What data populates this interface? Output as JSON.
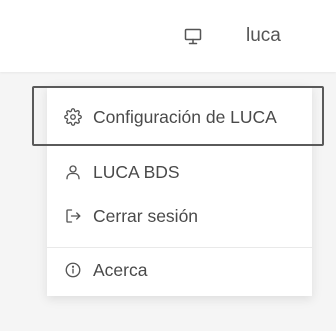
{
  "header": {
    "monitor_icon": "monitor-icon",
    "user_label": "luca"
  },
  "menu": {
    "items": [
      {
        "label": "Configuración de LUCA",
        "icon": "gear-icon"
      },
      {
        "label": "LUCA BDS",
        "icon": "user-icon"
      },
      {
        "label": "Cerrar sesión",
        "icon": "logout-icon"
      },
      {
        "label": "Acerca",
        "icon": "info-icon"
      }
    ]
  },
  "colors": {
    "background": "#f5f5f5",
    "surface": "#ffffff",
    "text": "#4a4a4a",
    "highlight_border": "#5a5a5a"
  }
}
